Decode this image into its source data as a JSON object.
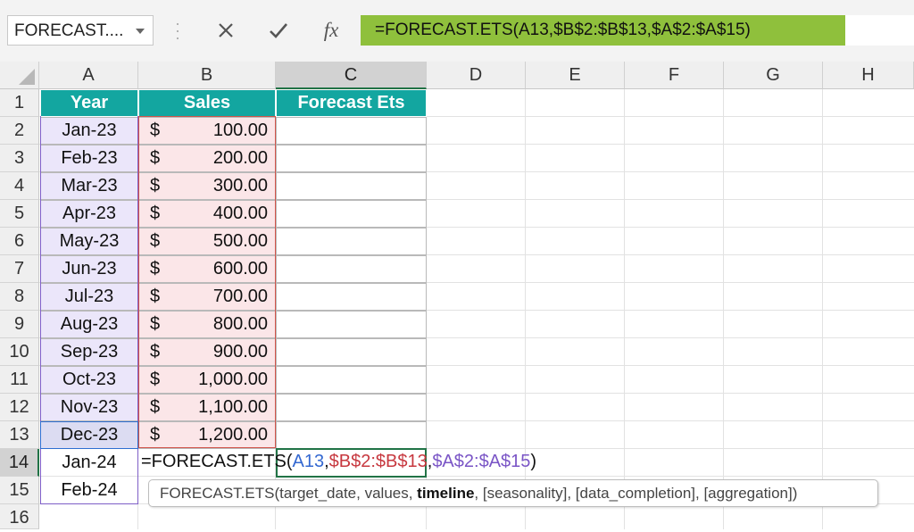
{
  "name_box": "FORECAST....",
  "formula_bar": {
    "fx": "fx",
    "formula": "=FORECAST.ETS(A13,$B$2:$B$13,$A$2:$A$15)"
  },
  "columns": [
    "A",
    "B",
    "C",
    "D",
    "E",
    "F",
    "G",
    "H"
  ],
  "rows": [
    "1",
    "2",
    "3",
    "4",
    "5",
    "6",
    "7",
    "8",
    "9",
    "10",
    "11",
    "12",
    "13",
    "14",
    "15",
    "16"
  ],
  "table": {
    "headers": {
      "year": "Year",
      "sales": "Sales",
      "forecast": "Forecast Ets"
    },
    "currency": "$",
    "data": [
      {
        "year": "Jan-23",
        "sales": "100.00"
      },
      {
        "year": "Feb-23",
        "sales": "200.00"
      },
      {
        "year": "Mar-23",
        "sales": "300.00"
      },
      {
        "year": "Apr-23",
        "sales": "400.00"
      },
      {
        "year": "May-23",
        "sales": "500.00"
      },
      {
        "year": "Jun-23",
        "sales": "600.00"
      },
      {
        "year": "Jul-23",
        "sales": "700.00"
      },
      {
        "year": "Aug-23",
        "sales": "800.00"
      },
      {
        "year": "Sep-23",
        "sales": "900.00"
      },
      {
        "year": "Oct-23",
        "sales": "1,000.00"
      },
      {
        "year": "Nov-23",
        "sales": "1,100.00"
      },
      {
        "year": "Dec-23",
        "sales": "1,200.00"
      }
    ],
    "extra_years": [
      "Jan-24",
      "Feb-24"
    ]
  },
  "cell_edit": {
    "prefix": "=FORECAST.ETS(",
    "arg1": "A13",
    "sep1": ",",
    "arg2": "$B$2:$B$13",
    "sep2": ",",
    "arg3": "$A$2:$A$15",
    "suffix": ")"
  },
  "tooltip": {
    "pre": "FORECAST.ETS(target_date, values, ",
    "bold": "timeline",
    "post": ", [seasonality], [data_completion], [aggregation])"
  },
  "colors": {
    "header_teal": "#13a6a0",
    "formula_highlight": "#8fc03c",
    "ref_blue": "#3468d1",
    "ref_red": "#c7383f",
    "ref_purple": "#7a55c6",
    "active_green": "#217346"
  }
}
